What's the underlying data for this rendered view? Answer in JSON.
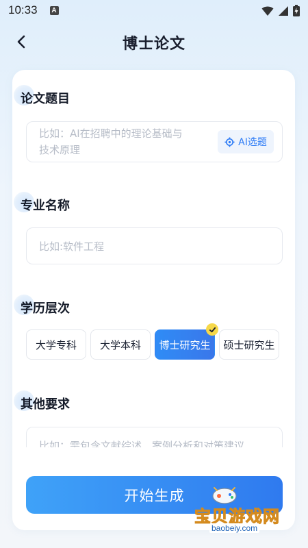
{
  "status_bar": {
    "time": "10:33",
    "notification_icon": "A"
  },
  "header": {
    "title": "博士论文",
    "back_icon": "chevron-left-icon"
  },
  "sections": {
    "thesis_topic": {
      "label": "论文题目",
      "placeholder_line1": "比如：AI在招聘中的理论基础与",
      "placeholder_line2": "技术原理",
      "ai_button_label": "AI选题"
    },
    "major": {
      "label": "专业名称",
      "placeholder": "比如:软件工程"
    },
    "education_level": {
      "label": "学历层次",
      "options": [
        "大学专科",
        "大学本科",
        "博士研究生",
        "硕士研究生"
      ],
      "selected": "博士研究生"
    },
    "other_requirements": {
      "label": "其他要求",
      "placeholder": "比如：需包含文献综述、案例分析和对策建议"
    }
  },
  "start_button_label": "开始生成",
  "watermark": {
    "text": "宝贝游戏网",
    "url": "baobeiy.com"
  },
  "colors": {
    "accent": "#2f7aef",
    "badge": "#f6d84a",
    "placeholder": "#b6bcc7"
  }
}
